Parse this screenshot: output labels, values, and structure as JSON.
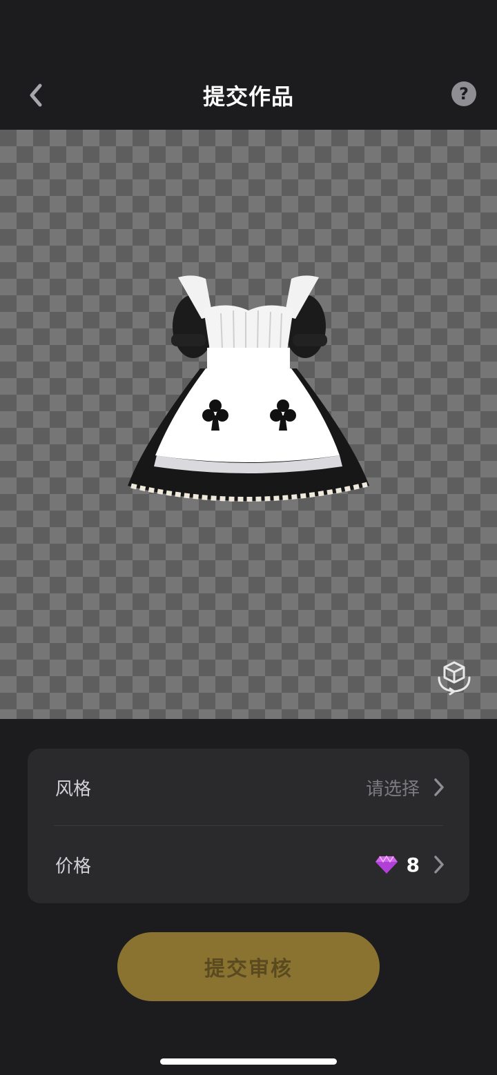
{
  "header": {
    "title": "提交作品",
    "back_icon": "chevron-left-icon",
    "help_icon": "question-mark-icon",
    "help_glyph": "?"
  },
  "preview": {
    "item": "maid-dress-3d-preview",
    "rotate_icon": "3d-rotate-icon"
  },
  "settings": {
    "rows": [
      {
        "label": "风格",
        "value": "请选择",
        "icon": "chevron-right-icon"
      },
      {
        "label": "价格",
        "value": "8",
        "currency_icon": "diamond-gem-icon",
        "icon": "chevron-right-icon"
      }
    ]
  },
  "submit": {
    "label": "提交审核"
  },
  "colors": {
    "background": "#1c1c1e",
    "card": "#2a2a2d",
    "submit_button": "#8a7330",
    "gem": "#d065e8"
  }
}
